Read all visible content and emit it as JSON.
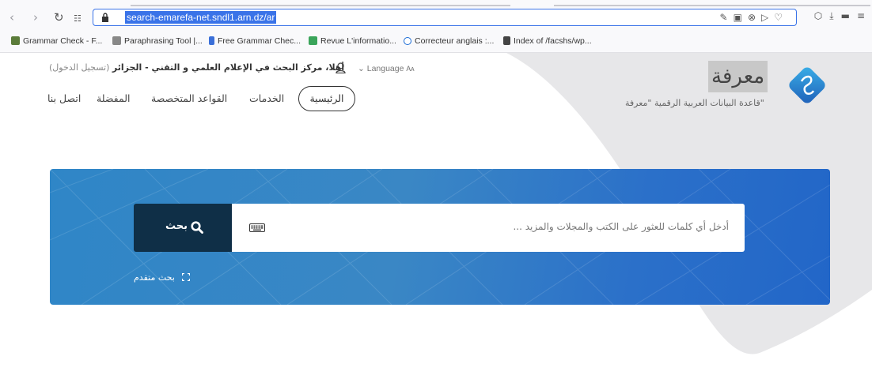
{
  "browser": {
    "url": "search-emarefa-net.sndl1.arn.dz/ar",
    "bookmarks": [
      "Grammar Check - F...",
      "Paraphrasing Tool |...",
      "Free Grammar Chec...",
      "Revue L'informatio...",
      "Correcteur anglais :...",
      "Index of /facshs/wp..."
    ]
  },
  "site": {
    "logo_word": "معرفة",
    "logo_subtitle": "قاعدة البيانات العربية الرقمية \"معرفة\"",
    "language_label": "Language",
    "welcome_text": "أهلا، مركز البحث في الإعلام العلمي و التقني - الجزائر",
    "login_text": "(تسجيل الدخول)",
    "nav": {
      "home": "الرئيسية",
      "services": "الخدمات",
      "specialized_db": "القواعد المتخصصة",
      "favorites": "المفضلة",
      "contact": "اتصل بنا"
    }
  },
  "search": {
    "button_label": "بحث",
    "placeholder": "أدخل أي كلمات للعثور على الكتب والمجلات والمزيد ...",
    "advanced_label": "بحث متقدم"
  },
  "colors": {
    "panel_start": "#2f86c7",
    "panel_end": "#2266c8",
    "button_bg": "#0f2f47",
    "url_highlight": "#3a73e8"
  }
}
